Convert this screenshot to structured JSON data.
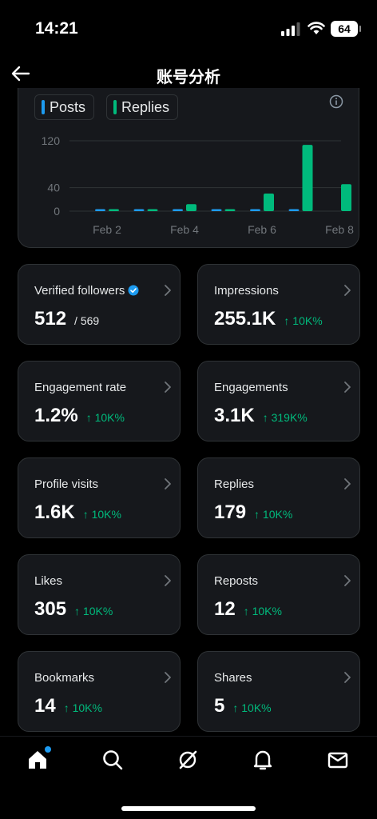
{
  "status_bar": {
    "time": "14:21",
    "battery": "64"
  },
  "header": {
    "title": "账号分析"
  },
  "chart_data": {
    "type": "bar",
    "legend": [
      {
        "name": "Posts",
        "color": "#1d9bf0"
      },
      {
        "name": "Replies",
        "color": "#00ba7c"
      }
    ],
    "x_tick_labels": [
      "Feb 2",
      "Feb 4",
      "Feb 6",
      "Feb 8"
    ],
    "y_tick_labels": [
      "120",
      "40",
      "0"
    ],
    "ylim": [
      0,
      120
    ],
    "categories": [
      "Feb 2",
      "Feb 3",
      "Feb 4",
      "Feb 5",
      "Feb 6",
      "Feb 7",
      "Feb 8"
    ],
    "series": [
      {
        "name": "Posts",
        "values": [
          1,
          2,
          2,
          1,
          3,
          3,
          0
        ]
      },
      {
        "name": "Replies",
        "values": [
          1,
          1,
          12,
          2,
          30,
          113,
          46
        ]
      }
    ],
    "grid": true
  },
  "stats": [
    {
      "label": "Verified followers",
      "value": "512",
      "sub": "/ 569",
      "delta": "",
      "verified": true
    },
    {
      "label": "Impressions",
      "value": "255.1K",
      "sub": "",
      "delta": "↑ 10K%"
    },
    {
      "label": "Engagement rate",
      "value": "1.2%",
      "sub": "",
      "delta": "↑ 10K%"
    },
    {
      "label": "Engagements",
      "value": "3.1K",
      "sub": "",
      "delta": "↑ 319K%"
    },
    {
      "label": "Profile visits",
      "value": "1.6K",
      "sub": "",
      "delta": "↑ 10K%"
    },
    {
      "label": "Replies",
      "value": "179",
      "sub": "",
      "delta": "↑ 10K%"
    },
    {
      "label": "Likes",
      "value": "305",
      "sub": "",
      "delta": "↑ 10K%"
    },
    {
      "label": "Reposts",
      "value": "12",
      "sub": "",
      "delta": "↑ 10K%"
    },
    {
      "label": "Bookmarks",
      "value": "14",
      "sub": "",
      "delta": "↑ 10K%"
    },
    {
      "label": "Shares",
      "value": "5",
      "sub": "",
      "delta": "↑ 10K%"
    }
  ],
  "nav": {
    "items": [
      "home-icon",
      "search-icon",
      "grok-icon",
      "notifications-icon",
      "messages-icon"
    ],
    "accent": "#1d9bf0"
  }
}
